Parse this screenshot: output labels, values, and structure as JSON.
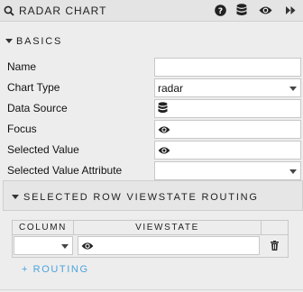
{
  "header": {
    "title": "RADAR CHART",
    "icons": [
      "search-icon",
      "help-icon",
      "database-icon",
      "eye-icon",
      "fast-forward-icon"
    ]
  },
  "basics": {
    "title": "BASICS",
    "fields": {
      "name": {
        "label": "Name",
        "value": ""
      },
      "chart_type": {
        "label": "Chart Type",
        "value": "radar"
      },
      "data_source": {
        "label": "Data Source",
        "icon": "database-icon"
      },
      "focus": {
        "label": "Focus",
        "icon": "eye-icon"
      },
      "selected_value": {
        "label": "Selected Value",
        "icon": "eye-icon"
      },
      "selected_value_attribute": {
        "label": "Selected Value Attribute",
        "value": ""
      }
    }
  },
  "routing": {
    "title": "SELECTED ROW VIEWSTATE ROUTING",
    "columns": [
      "COLUMN",
      "VIEWSTATE"
    ],
    "row": {
      "column_value": "",
      "viewstate_icon": "eye-icon",
      "delete_icon": "trash-icon"
    },
    "add_label": "+ ROUTING"
  }
}
